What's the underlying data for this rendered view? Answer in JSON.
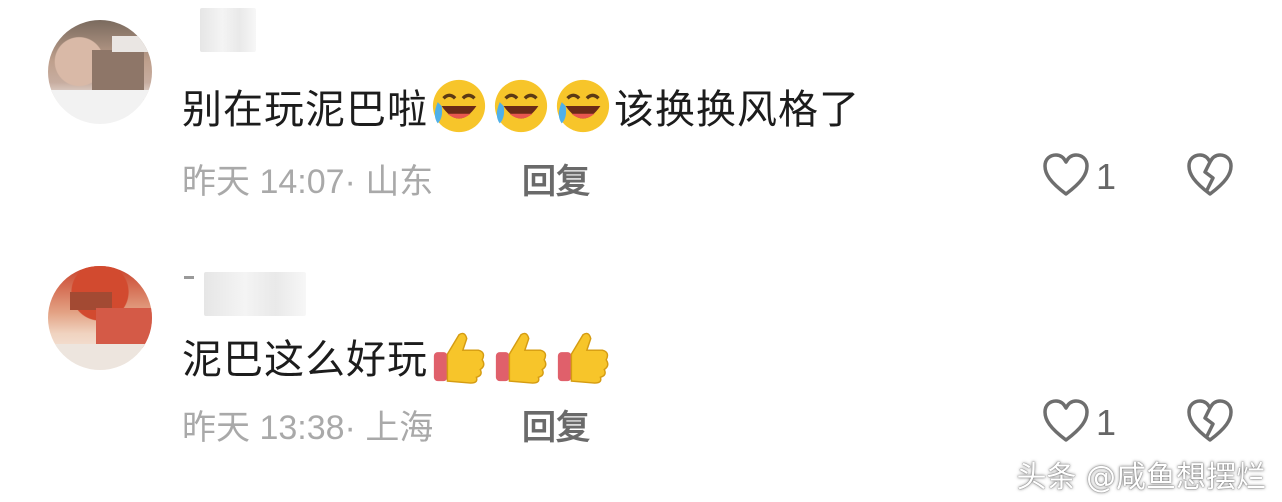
{
  "comments": [
    {
      "text": "别在玩泥巴啦",
      "emoji": "face-with-tears-of-joy",
      "emoji_count": 3,
      "text_after": "该换换风格了",
      "time": "昨天 14:07",
      "location": "山东",
      "reply_label": "回复",
      "likes": "1"
    },
    {
      "text": "泥巴这么好玩",
      "emoji": "thumbs-up",
      "emoji_count": 3,
      "text_after": "",
      "time": "昨天 13:38",
      "location": "上海",
      "reply_label": "回复",
      "likes": "1"
    }
  ],
  "watermark": "头条 @咸鱼想摆烂",
  "colors": {
    "meta_text": "#a9a9a9",
    "reply_text": "#6a6a6a",
    "icon_stroke": "#6e6e6e"
  }
}
